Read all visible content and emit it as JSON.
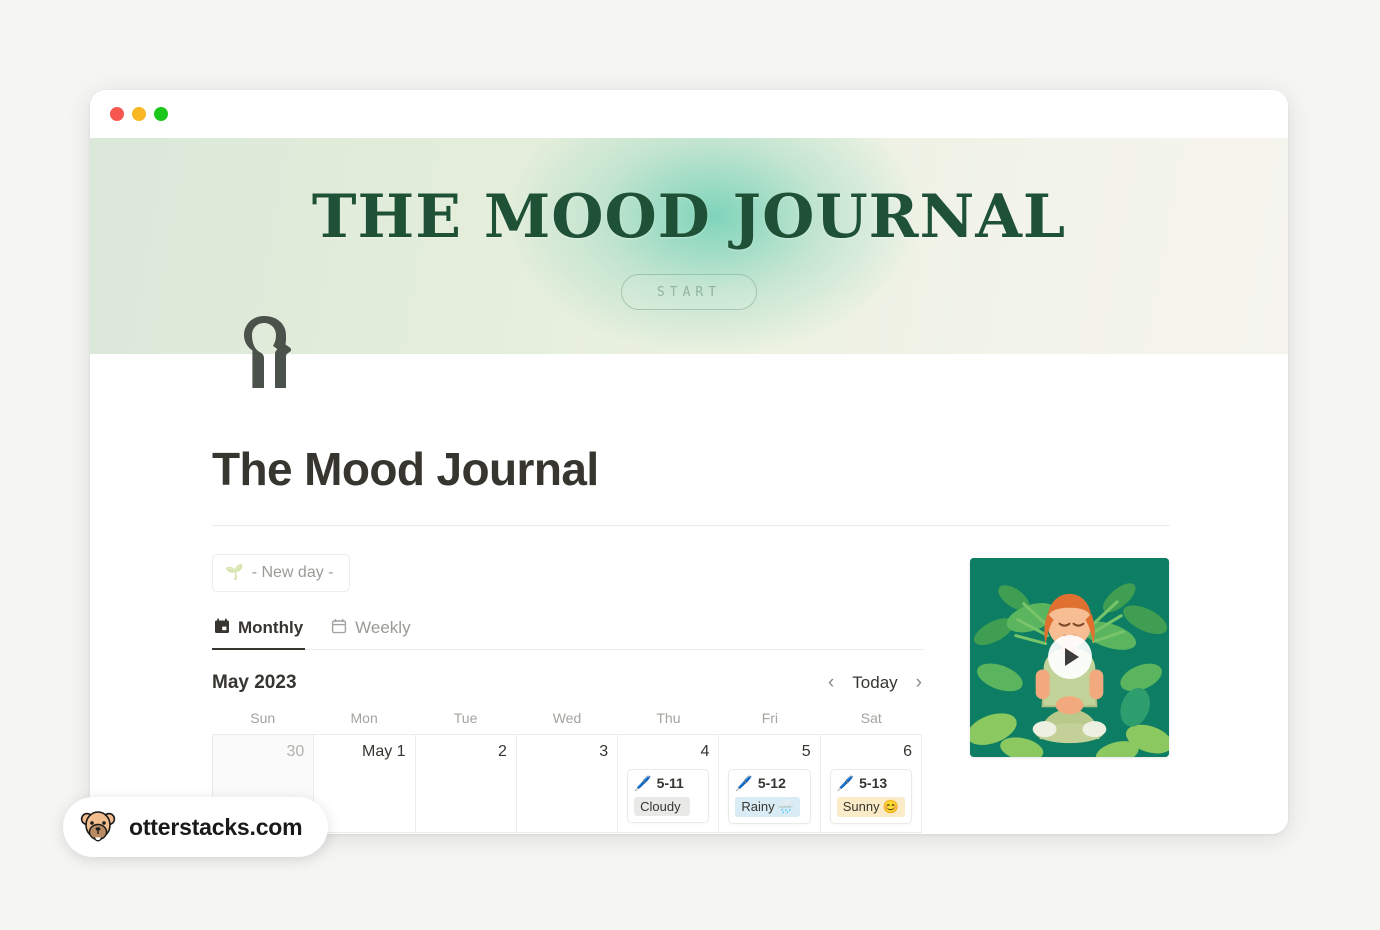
{
  "window": {
    "traffic_lights": [
      "close",
      "minimize",
      "maximize"
    ],
    "colors": {
      "close": "#f6574f",
      "minimize": "#f9b723",
      "maximize": "#1bc71b"
    }
  },
  "hero": {
    "title": "THE MOOD JOURNAL",
    "start_label": "START",
    "title_color": "#1f5137",
    "gradient_from": "#dbe8da",
    "gradient_to": "#f5f4ee",
    "accent": "#6ccfb4"
  },
  "brand": {
    "icon": "head-profile-icon"
  },
  "page": {
    "title": "The Mood Journal"
  },
  "toolbar": {
    "new_day_label": "- New day -",
    "new_day_icon": "upload-icon"
  },
  "tabs": [
    {
      "label": "Monthly",
      "icon": "calendar-filled-icon",
      "active": true
    },
    {
      "label": "Weekly",
      "icon": "calendar-outline-icon",
      "active": false
    }
  ],
  "calendar": {
    "month_label": "May 2023",
    "prev_label": "‹",
    "next_label": "›",
    "today_label": "Today",
    "weekdays": [
      "Sun",
      "Mon",
      "Tue",
      "Wed",
      "Thu",
      "Fri",
      "Sat"
    ],
    "cells": [
      {
        "num": "30",
        "muted": true,
        "events": []
      },
      {
        "num": "May 1",
        "muted": false,
        "events": []
      },
      {
        "num": "2",
        "muted": false,
        "events": []
      },
      {
        "num": "3",
        "muted": false,
        "events": []
      },
      {
        "num": "4",
        "muted": false,
        "events": [
          {
            "icon": "🖊️",
            "title": "5-11",
            "tag": "Cloudy",
            "tag_emoji": "",
            "tag_color": "gray"
          }
        ]
      },
      {
        "num": "5",
        "muted": false,
        "events": [
          {
            "icon": "🖊️",
            "title": "5-12",
            "tag": "Rainy",
            "tag_emoji": "🌧️",
            "tag_color": "blue"
          }
        ]
      },
      {
        "num": "6",
        "muted": false,
        "events": [
          {
            "icon": "🖊️",
            "title": "5-13",
            "tag": "Sunny",
            "tag_emoji": "😊",
            "tag_color": "yellow"
          }
        ]
      }
    ]
  },
  "media": {
    "type": "video-thumbnail",
    "alt": "Person meditating surrounded by green plants",
    "play_icon": "play-icon",
    "background_color": "#0f7a62"
  },
  "watermark": {
    "text": "otterstacks.com",
    "icon": "otter-face-icon"
  }
}
